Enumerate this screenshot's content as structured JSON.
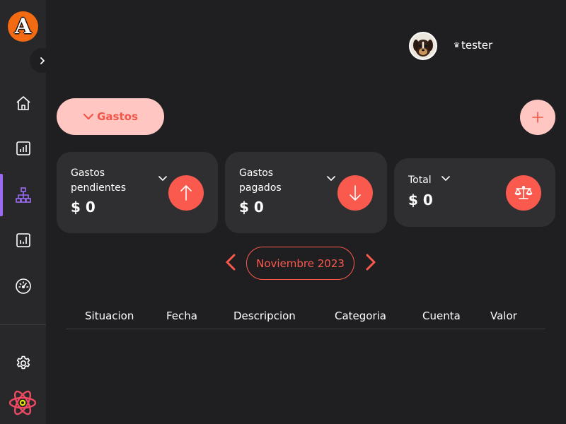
{
  "sidebar": {
    "logo_letter": "A",
    "items": [
      {
        "name": "home"
      },
      {
        "name": "reports"
      },
      {
        "name": "hierarchy",
        "active": true
      },
      {
        "name": "statistics"
      },
      {
        "name": "dashboard"
      }
    ],
    "active_color": "#9b6cf3"
  },
  "header": {
    "user_name": "tester",
    "crown": "♛"
  },
  "section": {
    "label": "Gastos"
  },
  "cards": [
    {
      "label": "Gastos\npendientes",
      "value": "$ 0",
      "icon": "arrow-up-icon"
    },
    {
      "label": "Gastos\npagados",
      "value": "$ 0",
      "icon": "arrow-down-icon"
    },
    {
      "label": "Total",
      "value": "$ 0",
      "icon": "scale-icon"
    }
  ],
  "month": {
    "label": "Noviembre 2023"
  },
  "table": {
    "headers": [
      "Situacion",
      "Fecha",
      "Descripcion",
      "Categoria",
      "Cuenta",
      "Valor"
    ],
    "rows": []
  },
  "colors": {
    "accent": "#fa5a4e",
    "accent_light": "#ffc6c2",
    "background": "#1f1e20",
    "card": "#2f2f31"
  }
}
